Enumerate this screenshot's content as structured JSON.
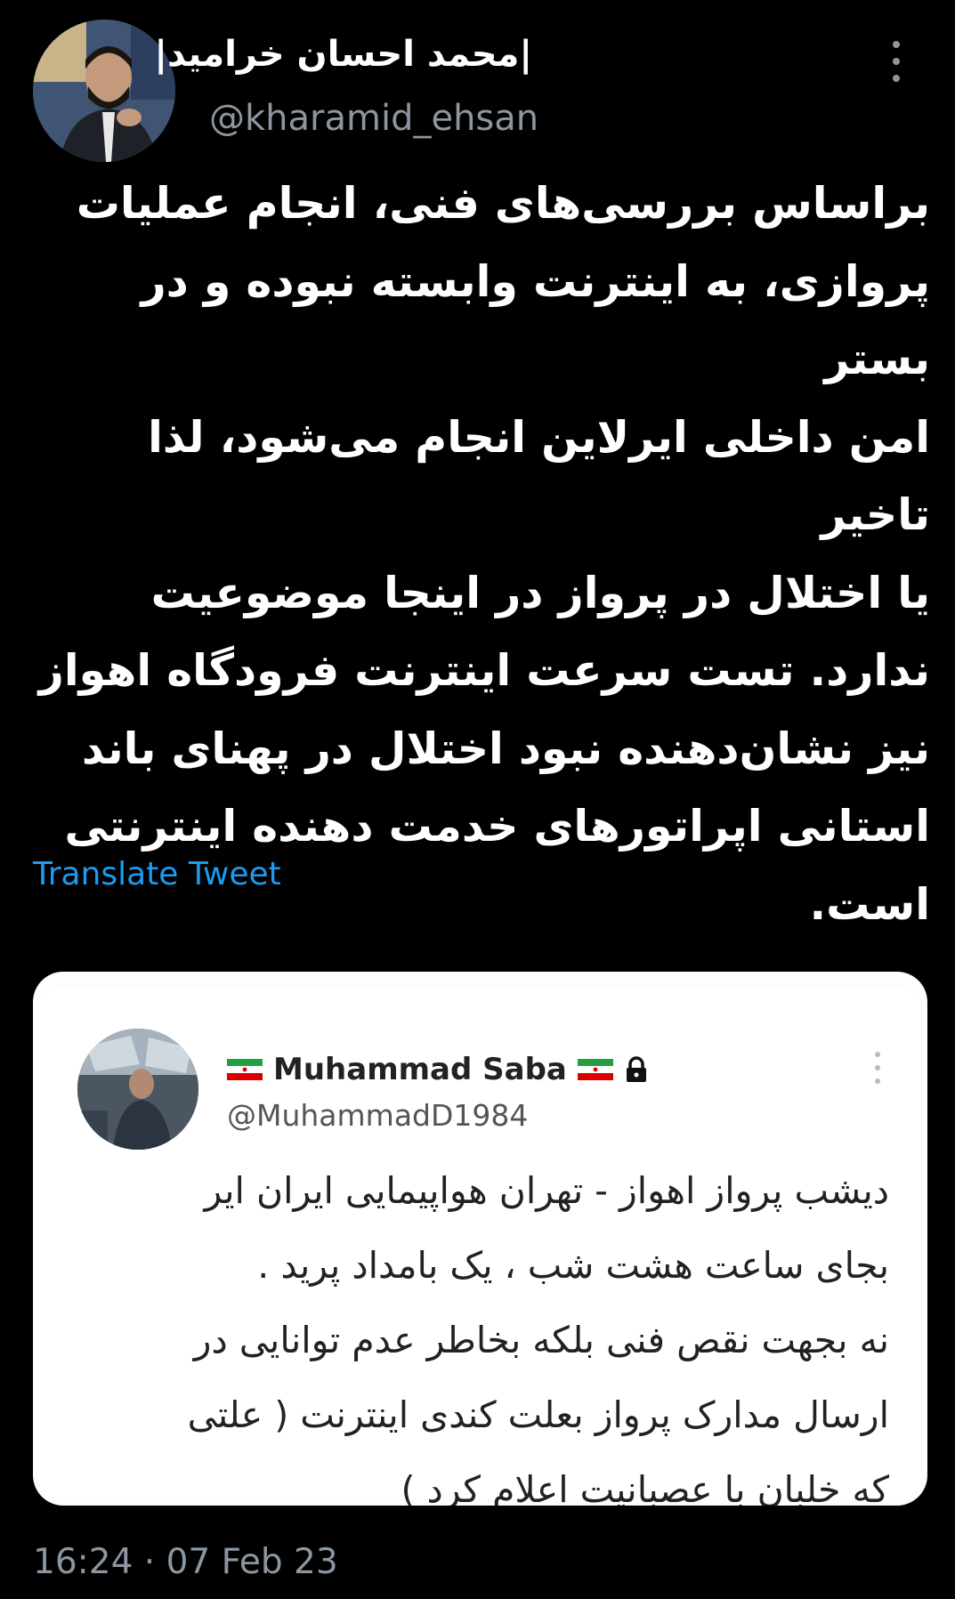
{
  "author": {
    "name": "|محمد احسان خرامید|",
    "handle": "@kharamid_ehsan"
  },
  "tweet": {
    "lines": [
      "براساس بررسی‌های فنی، انجام عملیات",
      "پروازی، به اینترنت وابسته نبوده و در بستر",
      "امن داخلی ایرلاین انجام می‌شود، لذا تاخیر",
      "یا اختلال در پرواز در اینجا موضوعیت",
      "ندارد. تست سرعت اینترنت فرودگاه اهواز",
      "نیز نشان‌دهنده نبود اختلال در پهنای باند",
      "استانی اپراتورهای خدمت دهنده اینترنتی",
      "است."
    ],
    "translate_label": "Translate Tweet",
    "timestamp": "16:24 · 07 Feb 23"
  },
  "quoted": {
    "name": "Muhammad Saba",
    "handle": "@MuhammadD1984",
    "lines": [
      "دیشب پرواز اهواز - تهران هواپیمایی ایران ایر",
      "بجای ساعت هشت شب ، یک بامداد پرید .",
      "نه بجهت نقص فنی بلکه بخاطر عدم توانایی در",
      "ارسال مدارک پرواز بعلت کندی اینترنت ( علتی",
      "که خلبان با عصبانیت اعلام کرد )"
    ]
  },
  "icons": {
    "more": "more-vertical-icon",
    "flag": "iran-flag-icon",
    "lock": "lock-icon"
  },
  "colors": {
    "background": "#000000",
    "link": "#1d9bf0",
    "secondary": "#8b96a1",
    "quote_card": "#ffffff"
  }
}
